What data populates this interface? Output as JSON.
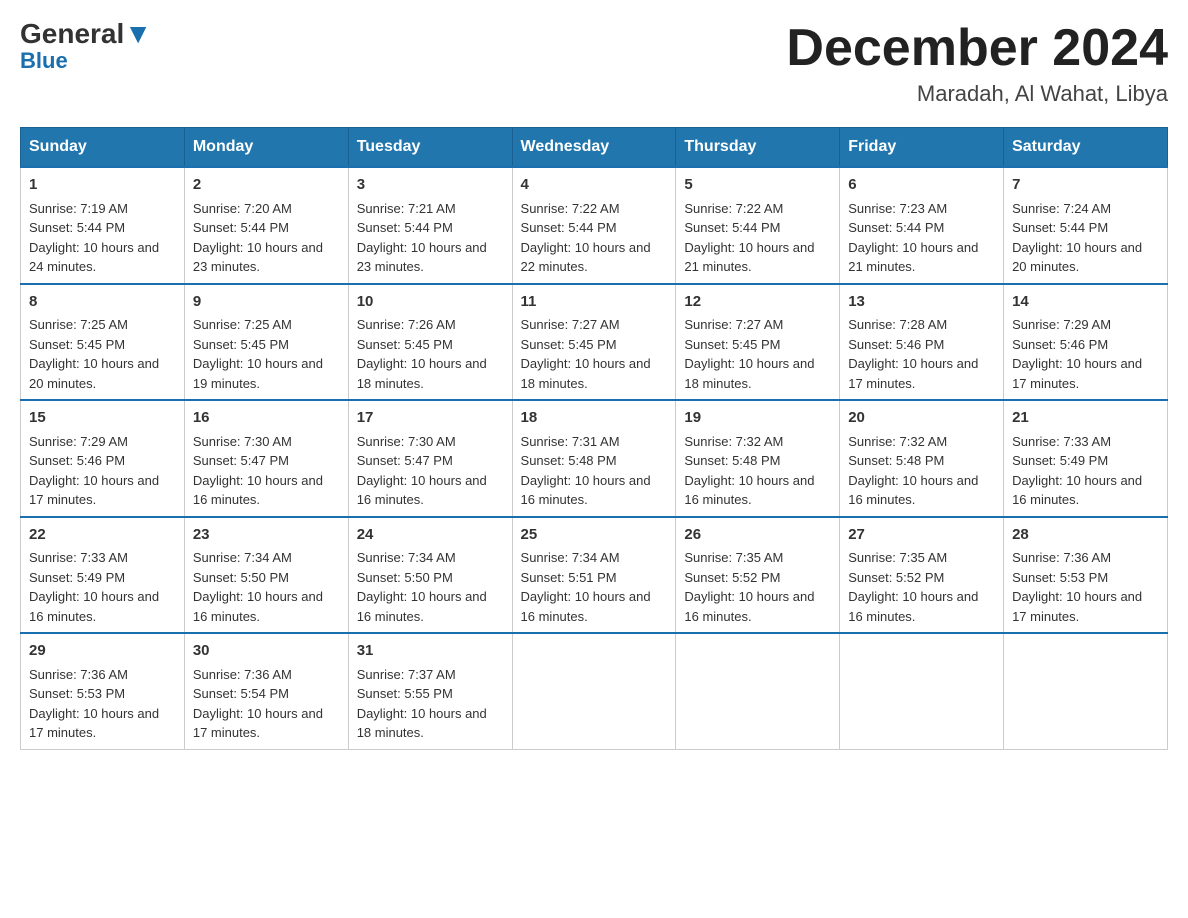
{
  "header": {
    "logo_general": "General",
    "logo_blue": "Blue",
    "month_title": "December 2024",
    "location": "Maradah, Al Wahat, Libya"
  },
  "days_of_week": [
    "Sunday",
    "Monday",
    "Tuesday",
    "Wednesday",
    "Thursday",
    "Friday",
    "Saturday"
  ],
  "weeks": [
    [
      {
        "day": "1",
        "sunrise": "7:19 AM",
        "sunset": "5:44 PM",
        "daylight": "10 hours and 24 minutes."
      },
      {
        "day": "2",
        "sunrise": "7:20 AM",
        "sunset": "5:44 PM",
        "daylight": "10 hours and 23 minutes."
      },
      {
        "day": "3",
        "sunrise": "7:21 AM",
        "sunset": "5:44 PM",
        "daylight": "10 hours and 23 minutes."
      },
      {
        "day": "4",
        "sunrise": "7:22 AM",
        "sunset": "5:44 PM",
        "daylight": "10 hours and 22 minutes."
      },
      {
        "day": "5",
        "sunrise": "7:22 AM",
        "sunset": "5:44 PM",
        "daylight": "10 hours and 21 minutes."
      },
      {
        "day": "6",
        "sunrise": "7:23 AM",
        "sunset": "5:44 PM",
        "daylight": "10 hours and 21 minutes."
      },
      {
        "day": "7",
        "sunrise": "7:24 AM",
        "sunset": "5:44 PM",
        "daylight": "10 hours and 20 minutes."
      }
    ],
    [
      {
        "day": "8",
        "sunrise": "7:25 AM",
        "sunset": "5:45 PM",
        "daylight": "10 hours and 20 minutes."
      },
      {
        "day": "9",
        "sunrise": "7:25 AM",
        "sunset": "5:45 PM",
        "daylight": "10 hours and 19 minutes."
      },
      {
        "day": "10",
        "sunrise": "7:26 AM",
        "sunset": "5:45 PM",
        "daylight": "10 hours and 18 minutes."
      },
      {
        "day": "11",
        "sunrise": "7:27 AM",
        "sunset": "5:45 PM",
        "daylight": "10 hours and 18 minutes."
      },
      {
        "day": "12",
        "sunrise": "7:27 AM",
        "sunset": "5:45 PM",
        "daylight": "10 hours and 18 minutes."
      },
      {
        "day": "13",
        "sunrise": "7:28 AM",
        "sunset": "5:46 PM",
        "daylight": "10 hours and 17 minutes."
      },
      {
        "day": "14",
        "sunrise": "7:29 AM",
        "sunset": "5:46 PM",
        "daylight": "10 hours and 17 minutes."
      }
    ],
    [
      {
        "day": "15",
        "sunrise": "7:29 AM",
        "sunset": "5:46 PM",
        "daylight": "10 hours and 17 minutes."
      },
      {
        "day": "16",
        "sunrise": "7:30 AM",
        "sunset": "5:47 PM",
        "daylight": "10 hours and 16 minutes."
      },
      {
        "day": "17",
        "sunrise": "7:30 AM",
        "sunset": "5:47 PM",
        "daylight": "10 hours and 16 minutes."
      },
      {
        "day": "18",
        "sunrise": "7:31 AM",
        "sunset": "5:48 PM",
        "daylight": "10 hours and 16 minutes."
      },
      {
        "day": "19",
        "sunrise": "7:32 AM",
        "sunset": "5:48 PM",
        "daylight": "10 hours and 16 minutes."
      },
      {
        "day": "20",
        "sunrise": "7:32 AM",
        "sunset": "5:48 PM",
        "daylight": "10 hours and 16 minutes."
      },
      {
        "day": "21",
        "sunrise": "7:33 AM",
        "sunset": "5:49 PM",
        "daylight": "10 hours and 16 minutes."
      }
    ],
    [
      {
        "day": "22",
        "sunrise": "7:33 AM",
        "sunset": "5:49 PM",
        "daylight": "10 hours and 16 minutes."
      },
      {
        "day": "23",
        "sunrise": "7:34 AM",
        "sunset": "5:50 PM",
        "daylight": "10 hours and 16 minutes."
      },
      {
        "day": "24",
        "sunrise": "7:34 AM",
        "sunset": "5:50 PM",
        "daylight": "10 hours and 16 minutes."
      },
      {
        "day": "25",
        "sunrise": "7:34 AM",
        "sunset": "5:51 PM",
        "daylight": "10 hours and 16 minutes."
      },
      {
        "day": "26",
        "sunrise": "7:35 AM",
        "sunset": "5:52 PM",
        "daylight": "10 hours and 16 minutes."
      },
      {
        "day": "27",
        "sunrise": "7:35 AM",
        "sunset": "5:52 PM",
        "daylight": "10 hours and 16 minutes."
      },
      {
        "day": "28",
        "sunrise": "7:36 AM",
        "sunset": "5:53 PM",
        "daylight": "10 hours and 17 minutes."
      }
    ],
    [
      {
        "day": "29",
        "sunrise": "7:36 AM",
        "sunset": "5:53 PM",
        "daylight": "10 hours and 17 minutes."
      },
      {
        "day": "30",
        "sunrise": "7:36 AM",
        "sunset": "5:54 PM",
        "daylight": "10 hours and 17 minutes."
      },
      {
        "day": "31",
        "sunrise": "7:37 AM",
        "sunset": "5:55 PM",
        "daylight": "10 hours and 18 minutes."
      },
      null,
      null,
      null,
      null
    ]
  ],
  "labels": {
    "sunrise": "Sunrise:",
    "sunset": "Sunset:",
    "daylight": "Daylight:"
  }
}
